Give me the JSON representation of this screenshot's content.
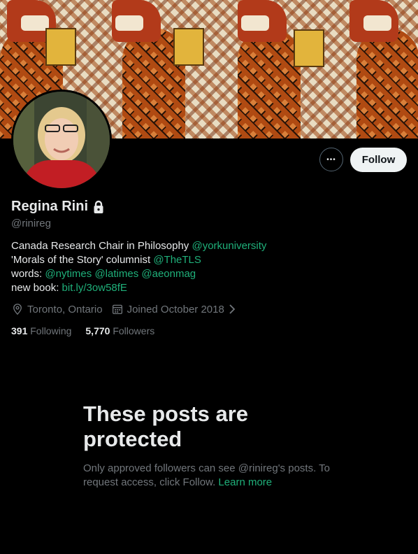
{
  "profile": {
    "name": "Regina Rini",
    "handle": "@rinireg",
    "bio_line1_text": "Canada Research Chair in Philosophy ",
    "bio_line1_link": "@yorkuniversity",
    "bio_line2_text": "'Morals of the Story' columnist ",
    "bio_line2_link": "@TheTLS",
    "bio_line3_text": "words: ",
    "bio_line3_link1": "@nytimes",
    "bio_line3_link2": "@latimes",
    "bio_line3_link3": "@aeonmag",
    "bio_line4_text": "new book: ",
    "bio_line4_link": "bit.ly/3ow58fE",
    "location": "Toronto, Ontario",
    "joined": "Joined October 2018"
  },
  "stats": {
    "following_count": "391",
    "following_label": "Following",
    "followers_count": "5,770",
    "followers_label": "Followers"
  },
  "actions": {
    "more_icon": "more-horizontal-icon",
    "more_glyph": "•••",
    "follow_label": "Follow"
  },
  "protected": {
    "title": "These posts are protected",
    "message": "Only approved followers can see @rinireg's posts. To request access, click Follow.",
    "learn_more": "Learn more"
  },
  "icons": {
    "lock": "lock-icon",
    "location": "location-pin-icon",
    "calendar": "calendar-icon",
    "chevron": "chevron-right-icon"
  },
  "colors": {
    "background": "#000000",
    "text": "#e7e9ea",
    "muted": "#71767b",
    "link": "#1fb07a",
    "follow_bg": "#eff3f4"
  }
}
